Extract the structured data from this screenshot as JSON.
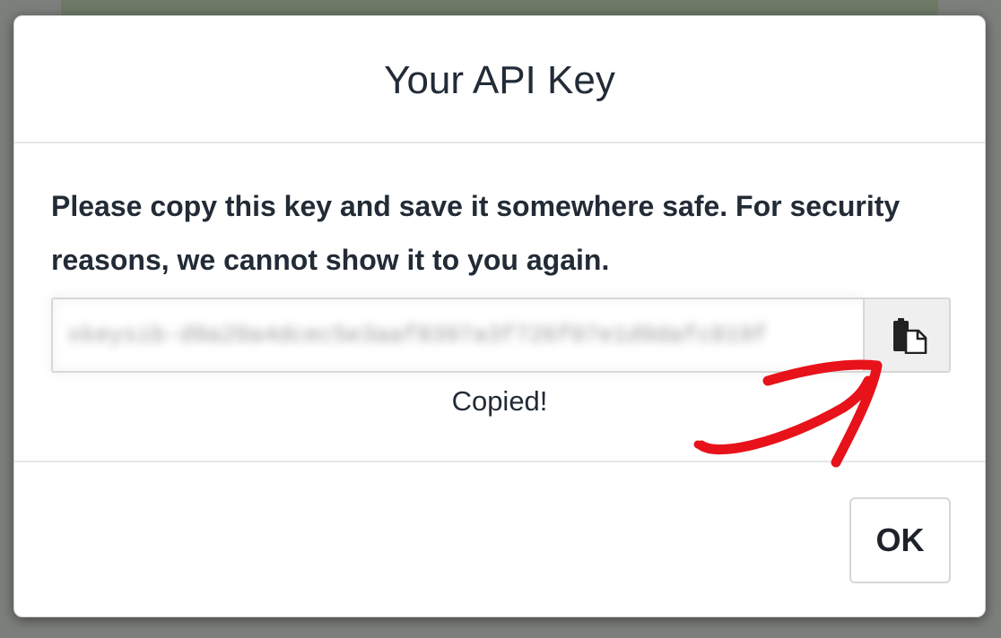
{
  "dialog": {
    "title": "Your API Key",
    "instructions": "Please copy this key and save it somewhere safe. For security reasons, we cannot show it to you again.",
    "key_value": "xkeysib-d9a20a4dcec5e3aaf8397a3f726f07e1d9dafc819f",
    "copy_icon": "copy-icon",
    "copied_text": "Copied!",
    "ok_label": "OK"
  },
  "colors": {
    "backdrop": "#7d7f7c",
    "text": "#222b36",
    "annotation_arrow": "#e8121a"
  }
}
